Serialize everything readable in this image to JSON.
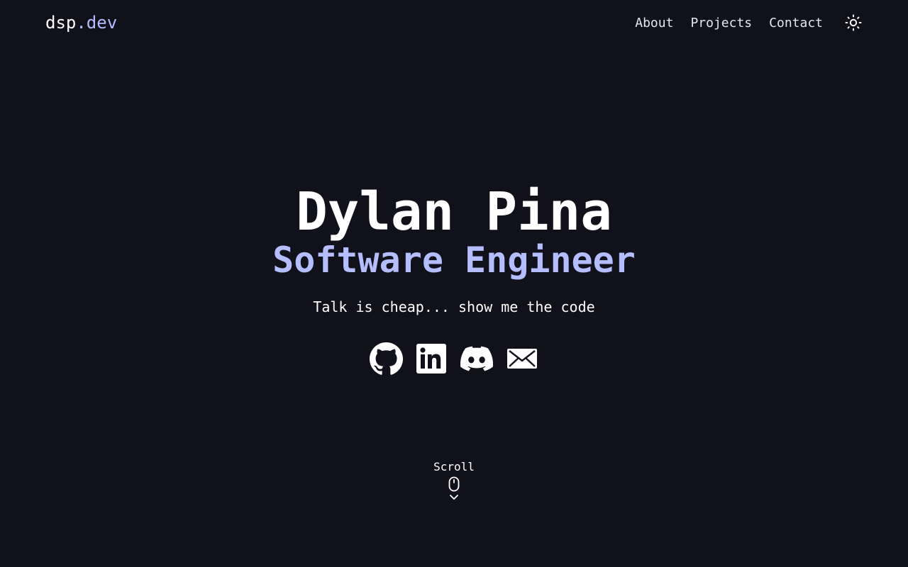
{
  "header": {
    "logo_main": "dsp",
    "logo_accent": ".dev",
    "nav": [
      {
        "label": "About"
      },
      {
        "label": "Projects"
      },
      {
        "label": "Contact"
      }
    ],
    "theme_icon": "sun-icon"
  },
  "hero": {
    "name": "Dylan Pina",
    "role": "Software Engineer",
    "tagline": "Talk is cheap... show me the code"
  },
  "socials": [
    {
      "icon": "github-icon"
    },
    {
      "icon": "linkedin-icon"
    },
    {
      "icon": "discord-icon"
    },
    {
      "icon": "email-icon"
    }
  ],
  "scroll": {
    "label": "Scroll",
    "icons": [
      "mouse-icon",
      "chevron-down-icon"
    ]
  },
  "colors": {
    "background": "#11111b",
    "accent": "#b4befe",
    "text": "#ffffff"
  }
}
